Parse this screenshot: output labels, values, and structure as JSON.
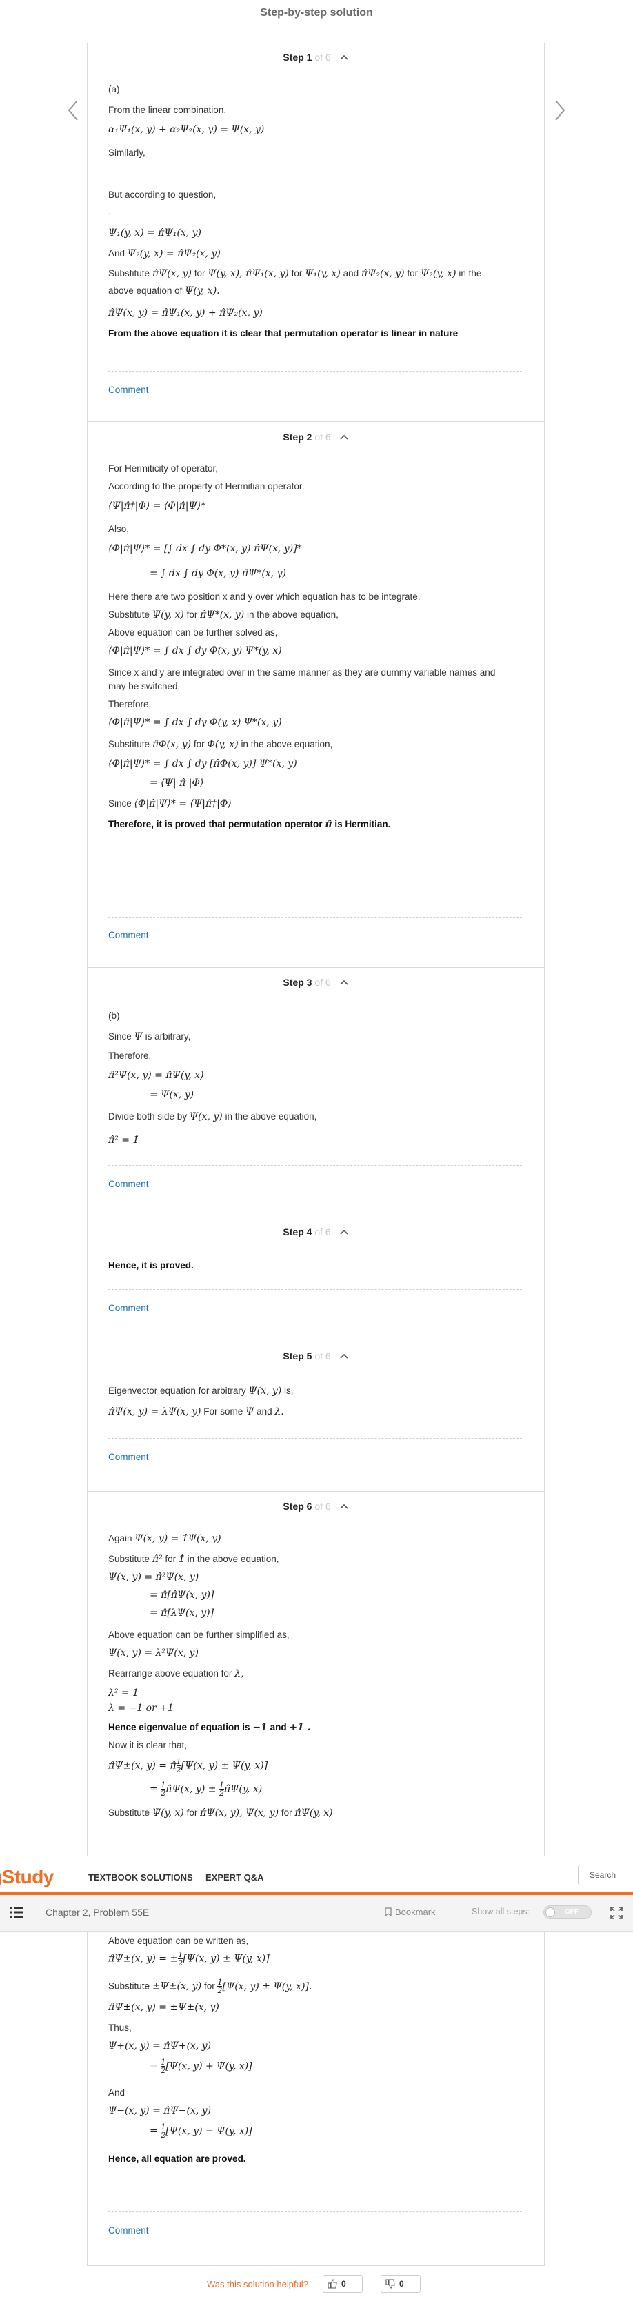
{
  "header": {
    "title": "Step-by-step solution"
  },
  "nav": {
    "prev_icon": "chevron-left-icon",
    "next_icon": "chevron-right-icon"
  },
  "steps": [
    {
      "label": "Step 1",
      "of": "of 6",
      "comment": "Comment"
    },
    {
      "label": "Step 2",
      "of": "of 6",
      "comment": "Comment"
    },
    {
      "label": "Step 3",
      "of": "of 6",
      "comment": "Comment"
    },
    {
      "label": "Step 4",
      "of": "of 6",
      "comment": "Comment"
    },
    {
      "label": "Step 5",
      "of": "of 6",
      "comment": "Comment"
    },
    {
      "label": "Step 6",
      "of": "of 6",
      "comment": "Comment"
    }
  ],
  "step1": {
    "part": "(a)",
    "t1": "From the linear combination,",
    "eq1": "α₁Ψ₁(x, y) + α₂Ψ₂(x, y) = Ψ(x, y)",
    "t2": "Similarly,",
    "t3": "But according to question,",
    "dot": "·",
    "eq2": "Ψ₁(y, x) = π̂Ψ₁(x, y)",
    "t4": "And",
    "eq3": "Ψ₂(y, x) = π̂Ψ₂(x, y)",
    "t5a": "Substitute",
    "t5b": "π̂Ψ(x, y)",
    "t5c": "for",
    "t5d": "Ψ(y, x), π̂Ψ₁(x, y)",
    "t5e": "for",
    "t5f": "Ψ₁(y, x)",
    "t5g": "and",
    "t5h": "π̂Ψ₂(x, y)",
    "t5i": "for",
    "t5j": "Ψ₂(y, x)",
    "t5k": "in the",
    "t6a": "above equation of",
    "t6b": "Ψ(y, x).",
    "eq4": "π̂Ψ(x, y) = π̂Ψ₁(x, y) + π̂Ψ₂(x, y)",
    "conclusion": "From the above equation it is clear that permutation operator is linear in nature"
  },
  "step2": {
    "t1": "For Hermiticity of operator,",
    "t2": "According to the property of Hermitian operator,",
    "eq1": "⟨Ψ|π̂†|Φ⟩ = ⟨Φ|π̂|Ψ⟩*",
    "t3": "Also,",
    "eq2a": "⟨Φ|π̂|Ψ⟩* = [∫ dx ∫ dy Φ*(x, y) π̂Ψ(x, y)]*",
    "eq2b": "= ∫ dx ∫ dy Φ(x, y) π̂Ψ*(x, y)",
    "t4": "Here there are two position  x and y over which equation has to be integrate.",
    "t5a": "Substitute",
    "t5b": "Ψ(y, x)",
    "t5c": "for",
    "t5d": "π̂Ψ*(x, y)",
    "t5e": "in the above equation,",
    "t6": "Above equation can be further solved as,",
    "eq3": "⟨Φ|π̂|Ψ⟩* = ∫ dx ∫ dy Φ(x, y) Ψ*(y, x)",
    "t7a": "Since",
    "t7b": "x and  y are integrated over in the same manner as they are dummy variable names and",
    "t7c": "may be switched.",
    "t8": "Therefore,",
    "eq4": "⟨Φ|π̂|Ψ⟩* = ∫ dx ∫ dy Φ(y, x) Ψ*(x, y)",
    "t9a": "Substitute",
    "t9b": "π̂Φ(x, y)",
    "t9c": "for",
    "t9d": "Φ(y, x)",
    "t9e": "in the above equation,",
    "eq5a": "⟨Φ|π̂|Ψ⟩* = ∫ dx ∫ dy [π̂Φ(x, y)] Ψ*(x, y)",
    "eq5b": "= ⟨Ψ| π̂ |Φ⟩",
    "t10a": "Since",
    "t10b": "⟨Φ|π̂|Ψ⟩* = ⟨Ψ|π̂†|Φ⟩",
    "conclusion_a": "Therefore, it is proved that permutation operator",
    "conclusion_b": "π̂",
    "conclusion_c": "is Hermitian."
  },
  "step3": {
    "part": "(b)",
    "t1a": "Since",
    "t1b": "Ψ",
    "t1c": "is arbitrary,",
    "t2": "Therefore,",
    "eq1a": "π̂²Ψ(x, y) = π̂Ψ(y, x)",
    "eq1b": "= Ψ(x, y)",
    "t3a": "Divide both side by",
    "t3b": "Ψ(x, y)",
    "t3c": "in the above equation,",
    "eq2": "π̂² = 1̂"
  },
  "step4": {
    "t1": "Hence, it is proved."
  },
  "step5": {
    "t1a": "Eigenvector equation for arbitrary",
    "t1b": "Ψ(x, y)",
    "t1c": "is,",
    "eq1": "π̂Ψ(x, y) = λΨ(x, y)",
    "t2a": "For some",
    "t2b": "Ψ",
    "t2c": "and",
    "t2d": "λ."
  },
  "step6": {
    "t1a": "Again",
    "t1b": "Ψ(x, y) = 1̂Ψ(x, y)",
    "t2a": "Substitute",
    "t2b": "π̂²",
    "t2c": "for",
    "t2d": "1̂",
    "t2e": "in the above equation,",
    "eq1a": "Ψ(x, y) = π̂²Ψ(x, y)",
    "eq1b": "= π̂[π̂Ψ(x, y)]",
    "eq1c": "= π̂[λΨ(x, y)]",
    "t3": "Above equation can be further simplified as,",
    "eq2": "Ψ(x, y) = λ²Ψ(x, y)",
    "t4a": "Rearrange above equation for",
    "t4b": "λ,",
    "eq3a": "λ² = 1",
    "eq3b": "λ = −1 or +1",
    "t5a": "Hence eigenvalue of equation is",
    "t5b": "−1",
    "t5c": "and",
    "t5d": "+1 .",
    "t6": "Now it is clear that,",
    "eq4a": "π̂Ψ±(x, y) = π̂",
    "eq4a2": "[Ψ(x, y) ± Ψ(y, x)]",
    "eq4b2": "π̂Ψ(x, y) ±",
    "eq4b3": "π̂Ψ(y, x)",
    "t7a": "Substitute",
    "t7b": "Ψ(y, x)",
    "t7c": "for",
    "t7d": "π̂Ψ(x, y),  Ψ(x, y)",
    "t7e": "for",
    "t7f": "π̂Ψ(y, x)",
    "t8": "Above equation can be written as,",
    "eq5a": "π̂Ψ±(x, y) = ±",
    "eq5a2": "[Ψ(x, y) ± Ψ(y, x)]",
    "t9a": "Substitute",
    "t9b": "±Ψ±(x, y)",
    "t9c": "for",
    "t9d": "[Ψ(x, y) ± Ψ(y, x)].",
    "eq6": "π̂Ψ±(x, y) = ±Ψ±(x, y)",
    "t10": "Thus,",
    "eq7a": "Ψ+(x, y) = π̂Ψ+(x, y)",
    "eq7b2": "[Ψ(x, y) + Ψ(y, x)]",
    "t11": "And",
    "eq8a": "Ψ−(x, y) = π̂Ψ−(x, y)",
    "eq8b2": "[Ψ(x, y) − Ψ(y, x)]",
    "conclusion": "Hence, all equation are proved.",
    "half_num": "1",
    "half_den": "2"
  },
  "topbar": {
    "logo": "gStudy",
    "nav1": "TEXTBOOK SOLUTIONS",
    "nav2": "EXPERT Q&A",
    "search": "Search"
  },
  "subbar": {
    "chapter": "Chapter 2, Problem 55E",
    "bookmark": "Bookmark",
    "show_all": "Show all steps:",
    "toggle": "OFF"
  },
  "footer": {
    "question": "Was this solution helpful?",
    "up_count": "0",
    "down_count": "0"
  },
  "colors": {
    "brand": "#f26c22",
    "link": "#1a6fb0",
    "border": "#d9d9d9"
  }
}
